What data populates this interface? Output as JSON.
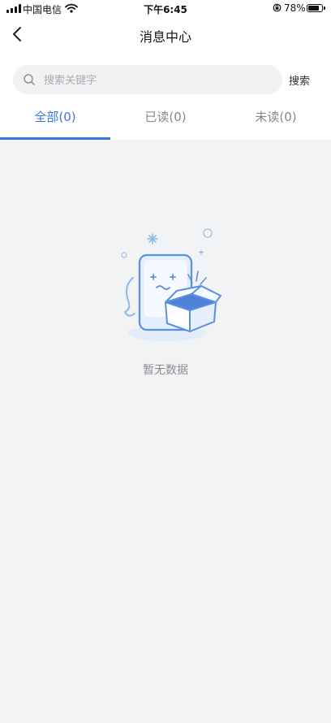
{
  "status_bar": {
    "carrier": "中国电信",
    "time": "下午6:45",
    "battery": "78%",
    "battery_level": 0.78
  },
  "header": {
    "title": "消息中心",
    "back_icon": "chevron-left-icon"
  },
  "search": {
    "placeholder": "搜索关键字",
    "value": "",
    "button_label": "搜索",
    "icon": "search-icon"
  },
  "tabs": [
    {
      "label": "全部(0)",
      "active": true
    },
    {
      "label": "已读(0)",
      "active": false
    },
    {
      "label": "未读(0)",
      "active": false
    }
  ],
  "empty_state": {
    "text": "暂无数据",
    "icon": "empty-box-illustration"
  },
  "colors": {
    "accent": "#3a77d8",
    "background": "#f2f3f5",
    "header_bg": "#ffffff",
    "muted_text": "#8a8c90"
  }
}
